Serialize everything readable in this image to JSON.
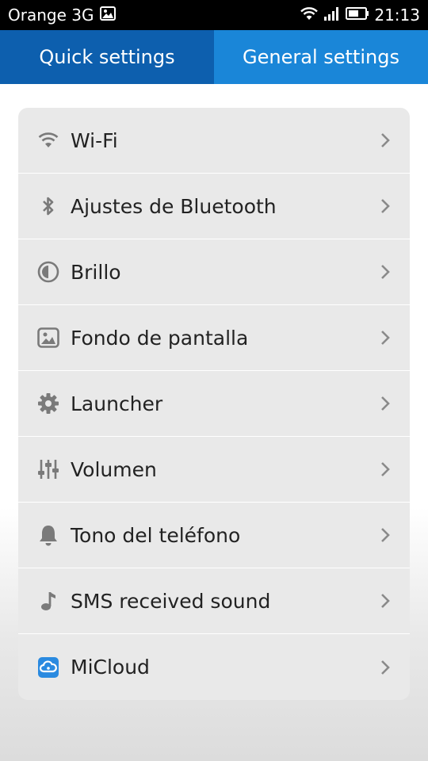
{
  "status_bar": {
    "carrier": "Orange 3G",
    "time": "21:13"
  },
  "tabs": [
    {
      "label": "Quick settings"
    },
    {
      "label": "General settings"
    }
  ],
  "settings": [
    {
      "label": "Wi-Fi",
      "icon": "wifi-icon"
    },
    {
      "label": "Ajustes de Bluetooth",
      "icon": "bluetooth-icon"
    },
    {
      "label": "Brillo",
      "icon": "brightness-icon"
    },
    {
      "label": "Fondo de pantalla",
      "icon": "wallpaper-icon"
    },
    {
      "label": "Launcher",
      "icon": "gear-icon"
    },
    {
      "label": "Volumen",
      "icon": "equalizer-icon"
    },
    {
      "label": "Tono del teléfono",
      "icon": "bell-icon"
    },
    {
      "label": "SMS received sound",
      "icon": "music-note-icon"
    },
    {
      "label": "MiCloud",
      "icon": "cloud-icon"
    }
  ],
  "colors": {
    "quick_tab": "#0d5fae",
    "general_tab": "#1a86d8",
    "card_bg": "#e9e9e9",
    "icon_gray": "#7a7a7a",
    "micloud_blue": "#2a8ae0"
  }
}
